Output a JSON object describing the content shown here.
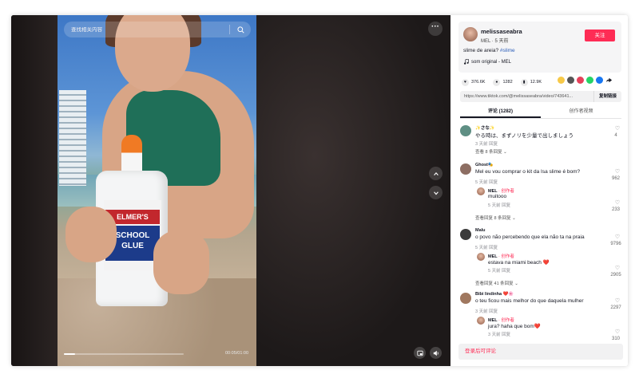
{
  "player": {
    "search_placeholder": "查找相关内容",
    "time": "00:05/01:00",
    "progress": 0.09
  },
  "author": {
    "name": "melissaseabra",
    "meta": "MEL · 5 天前",
    "follow_label": "关注",
    "description": "slime de areia? ",
    "hashtag": "#slime",
    "music": "som original - MEL"
  },
  "stats": {
    "likes": "376.6K",
    "comments": "1282",
    "saves": "12.9K"
  },
  "link": {
    "url": "https://www.tiktok.com/@melissaseabra/video/743641...",
    "copy_label": "复制链接"
  },
  "tabs": [
    {
      "label": "评论 (1282)",
      "active": true
    },
    {
      "label": "创作者视频",
      "active": false
    }
  ],
  "comments": [
    {
      "name": "✨さな✨",
      "text": "やる時は、まずノリを少量で出しましょう",
      "meta": "3 天前    回复",
      "likes": "4",
      "more": "查看 8 条回复 ⌄",
      "avatar_color": "#5f8f84"
    },
    {
      "name": "Ghost🎭",
      "text": "Mel eu vou comprar o kit da Isa slime é bom?",
      "meta": "5 天前    回复",
      "likes": "962",
      "more": "查看回复 8 条回复 ⌄",
      "avatar_color": "#8d6e63",
      "reply": {
        "name": "MEL",
        "tag": "· 创作者",
        "text": "muitooo",
        "meta": "5 天前    回复",
        "likes": "233"
      }
    },
    {
      "name": "Malu",
      "text": "o povo não percebendo que ela não ta na praia",
      "meta": "5 天前    回复",
      "likes": "9796",
      "more": "查看回复 41 条回复 ⌄",
      "avatar_color": "#3b3b3b",
      "reply": {
        "name": "MEL",
        "tag": "· 创作者",
        "text": "estava na miami beach ❤️",
        "meta": "5 天前    回复",
        "likes": "2905"
      }
    },
    {
      "name": "Bibi lindinha ❤️🌸",
      "text": "o teu ficou mais melhor do que daquela mulher",
      "meta": "3 天前    回复",
      "likes": "2297",
      "avatar_color": "#a0785f",
      "reply": {
        "name": "MEL",
        "tag": "· 创作者",
        "text": "jura? haha que bom❤️",
        "meta": "3 天前    回复",
        "likes": "310"
      }
    }
  ],
  "login_label": "登录后可评论",
  "colors": {
    "accent": "#fe2c55",
    "link": "#2b5db9"
  }
}
